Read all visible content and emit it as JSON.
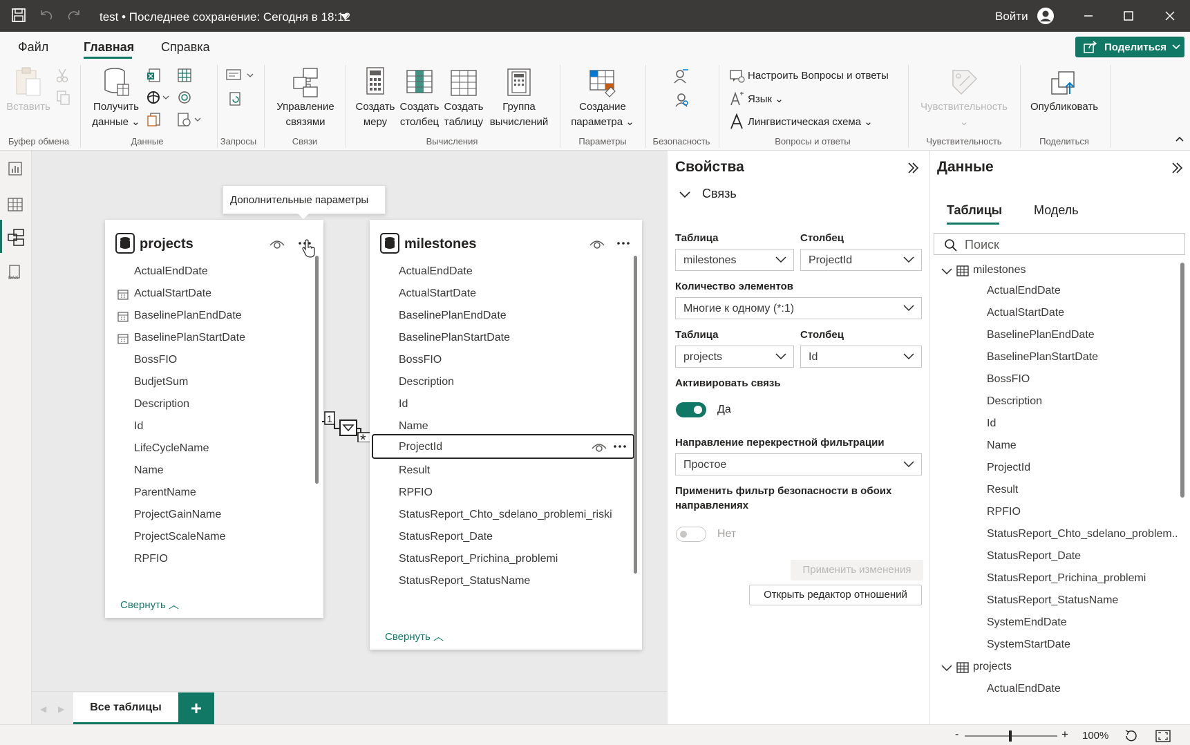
{
  "titlebar": {
    "title": "test • Последнее сохранение: Сегодня в 18:12",
    "signin": "Войти"
  },
  "menu": {
    "file": "Файл",
    "home": "Главная",
    "help": "Справка",
    "share": "Поделиться"
  },
  "ribbon": {
    "paste": "Вставить",
    "get_data_1": "Получить",
    "get_data_2": "данные",
    "manage_rel_1": "Управление",
    "manage_rel_2": "связями",
    "new_measure_1": "Создать",
    "new_measure_2": "меру",
    "new_column_1": "Создать",
    "new_column_2": "столбец",
    "new_table_1": "Создать",
    "new_table_2": "таблицу",
    "calc_group_1": "Группа",
    "calc_group_2": "вычислений",
    "new_param_1": "Создание",
    "new_param_2": "параметра",
    "qa_setup": "Настроить Вопросы и ответы",
    "language": "Язык",
    "linguistic": "Лингвистическая схема",
    "sensitivity": "Чувствительность",
    "publish": "Опубликовать",
    "groups": {
      "clipboard": "Буфер обмена",
      "data": "Данные",
      "queries": "Запросы",
      "relationships": "Связи",
      "calculations": "Вычисления",
      "parameters": "Параметры",
      "security": "Безопасность",
      "qa": "Вопросы и ответы",
      "sensitivity": "Чувствительность",
      "share": "Поделиться"
    }
  },
  "tooltip": "Дополнительные параметры",
  "projects_card": {
    "title": "projects",
    "fields": [
      "ActualEndDate",
      "ActualStartDate",
      "BaselinePlanEndDate",
      "BaselinePlanStartDate",
      "BossFIO",
      "BudjetSum",
      "Description",
      "Id",
      "LifeCycleName",
      "Name",
      "ParentName",
      "ProjectGainName",
      "ProjectScaleName",
      "RPFIO"
    ],
    "collapse": "Свернуть"
  },
  "milestones_card": {
    "title": "milestones",
    "fields": [
      "ActualEndDate",
      "ActualStartDate",
      "BaselinePlanEndDate",
      "BaselinePlanStartDate",
      "BossFIO",
      "Description",
      "Id",
      "Name",
      "ProjectId",
      "Result",
      "RPFIO",
      "StatusReport_Chto_sdelano_problemi_riski",
      "StatusReport_Date",
      "StatusReport_Prichina_problemi",
      "StatusReport_StatusName"
    ],
    "selected": "ProjectId",
    "collapse": "Свернуть"
  },
  "relationship": {
    "one": "1",
    "many": "*"
  },
  "properties": {
    "title": "Свойства",
    "section": "Связь",
    "table_label": "Таблица",
    "column_label": "Столбец",
    "table1": "milestones",
    "column1": "ProjectId",
    "cardinality_label": "Количество элементов",
    "cardinality": "Многие к одному (*:1)",
    "table2": "projects",
    "column2": "Id",
    "active_label": "Активировать связь",
    "active_value": "Да",
    "crossfilter_label": "Направление перекрестной фильтрации",
    "crossfilter": "Простое",
    "security_label_1": "Применить фильтр безопасности в обоих",
    "security_label_2": "направлениях",
    "security_value": "Нет",
    "apply": "Применить изменения",
    "open_editor": "Открыть редактор отношений"
  },
  "data_pane": {
    "title": "Данные",
    "tab_tables": "Таблицы",
    "tab_model": "Модель",
    "search_placeholder": "Поиск",
    "milestones": "milestones",
    "milestones_fields": [
      "ActualEndDate",
      "ActualStartDate",
      "BaselinePlanEndDate",
      "BaselinePlanStartDate",
      "BossFIO",
      "Description",
      "Id",
      "Name",
      "ProjectId",
      "Result",
      "RPFIO",
      "StatusReport_Chto_sdelano_problem...",
      "StatusReport_Date",
      "StatusReport_Prichina_problemi",
      "StatusReport_StatusName",
      "SystemEndDate",
      "SystemStartDate"
    ],
    "projects": "projects",
    "projects_fields": [
      "ActualEndDate"
    ]
  },
  "page_tab": "Все таблицы",
  "zoom": "100%"
}
